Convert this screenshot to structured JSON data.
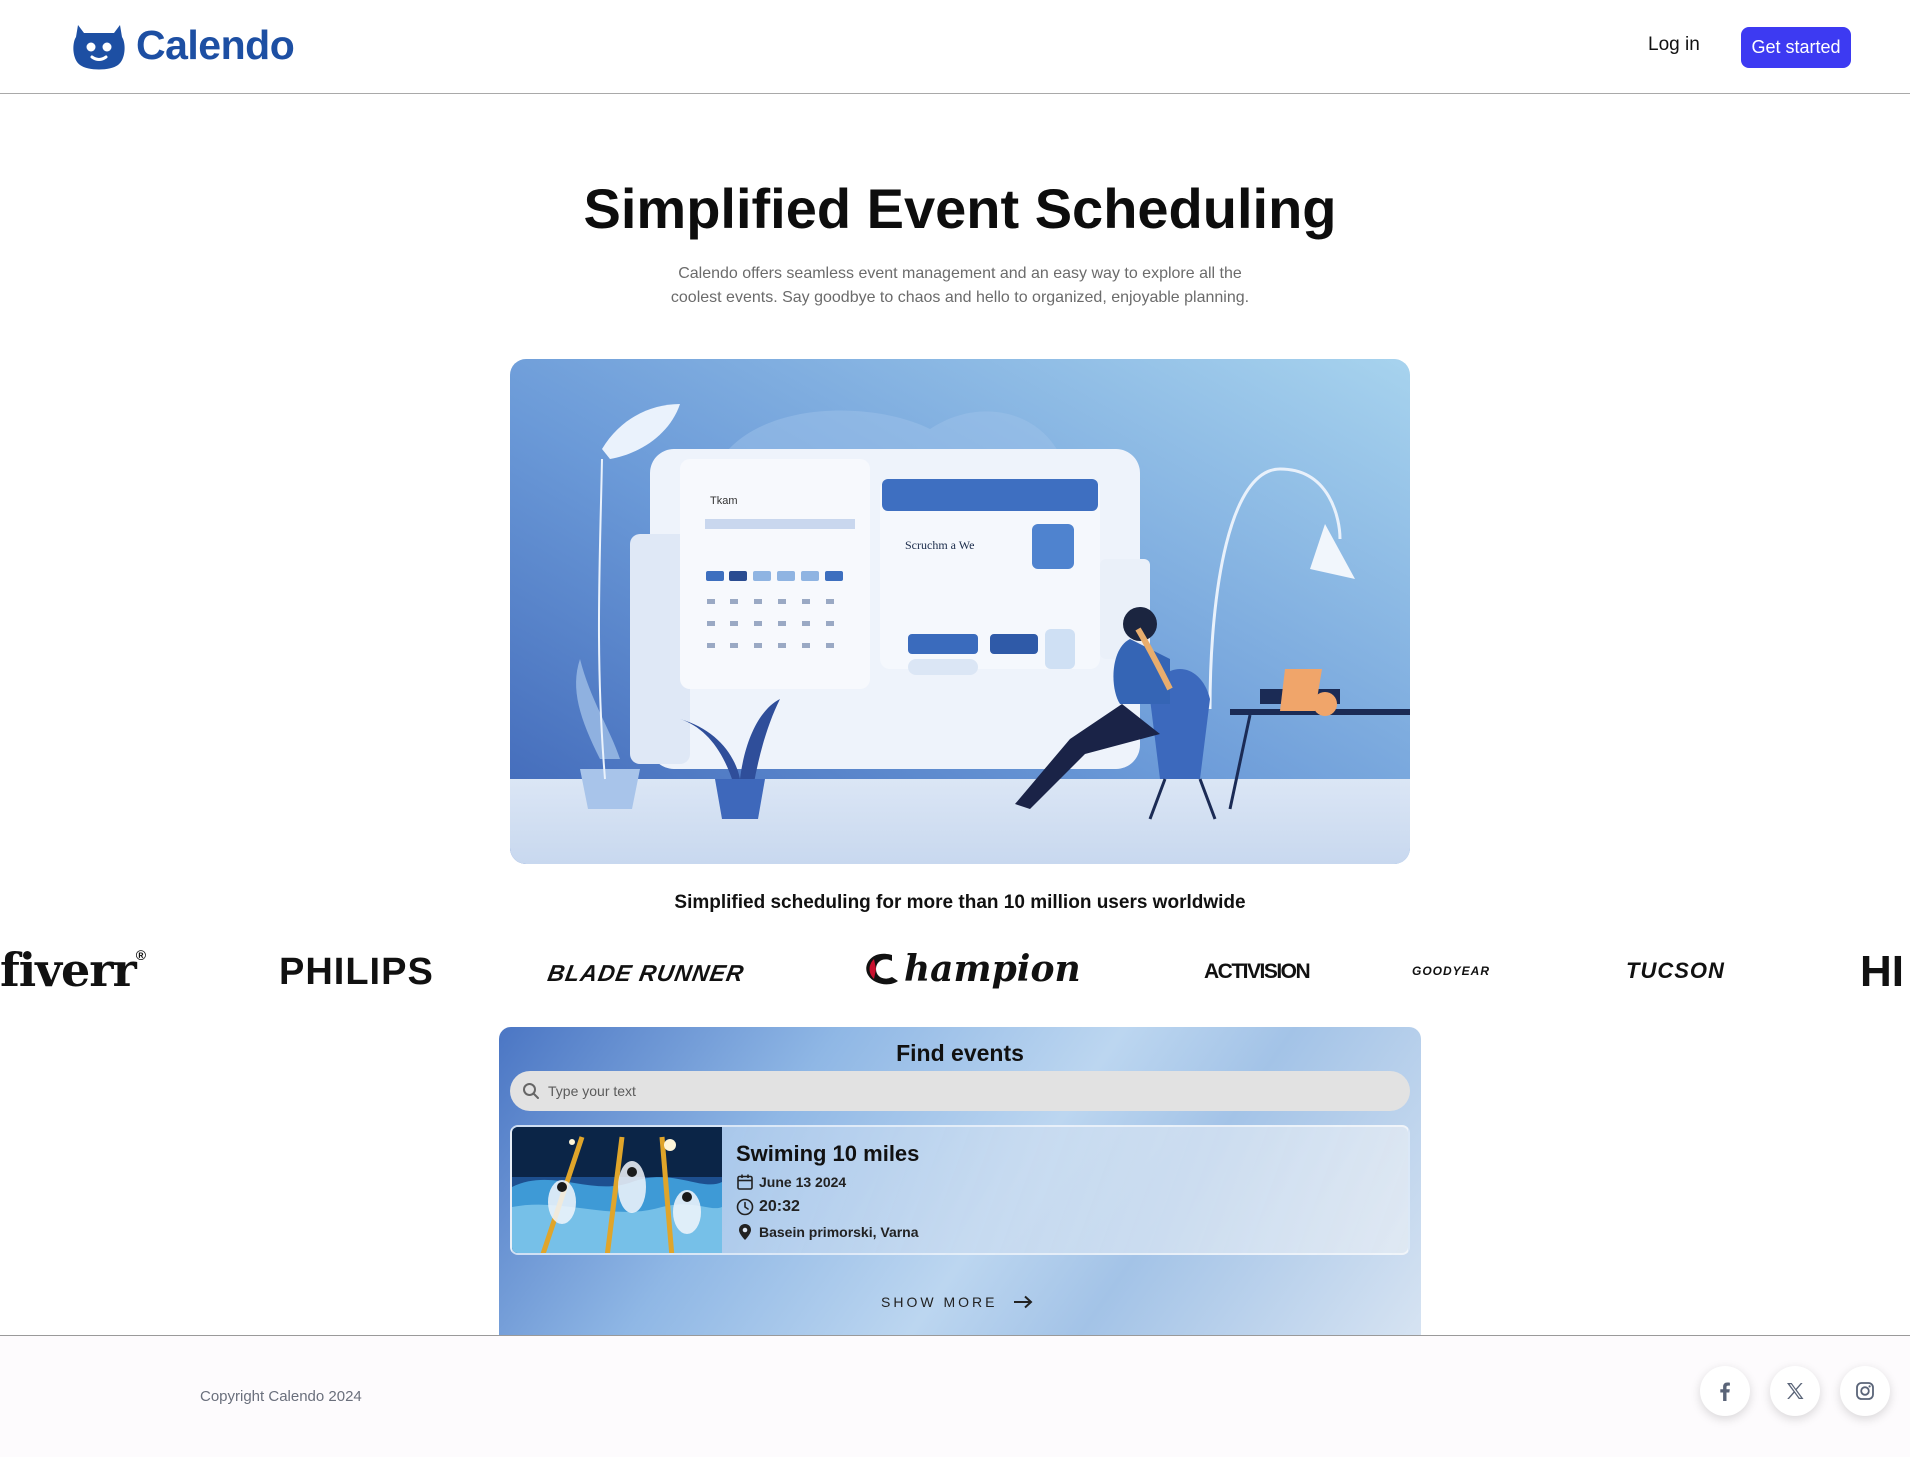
{
  "header": {
    "brand_name": "Calendo",
    "login_label": "Log in",
    "cta_label": "Get started",
    "brand_color": "#1d4fa3",
    "cta_color": "#3d3af2"
  },
  "hero": {
    "title": "Simplified Event Scheduling",
    "subtitle": "Calendo offers seamless event management and an easy way to explore all the coolest events. Say goodbye to chaos and hello to organized, enjoyable planning.",
    "illustration_labels": {
      "panel_left": "Tkam",
      "panel_right_title": "Scruchm a We"
    }
  },
  "users_line": "Simplified scheduling for more than 10 million users worldwide",
  "brands": [
    "fiverr",
    "PHILIPS",
    "BLADE RUNNER",
    "hampion",
    "ACTIVISION",
    "GOODYEAR",
    "TUCSON",
    "HI"
  ],
  "find_events": {
    "title": "Find events",
    "search_placeholder": "Type your text",
    "events": [
      {
        "title": "Swiming 10 miles",
        "date": "June 13 2024",
        "time": "20:32",
        "location": "Basein primorski, Varna"
      }
    ],
    "show_more_label": "SHOW MORE"
  },
  "footer": {
    "copyright": "Copyright Calendo 2024",
    "social_icons": [
      "facebook-icon",
      "x-icon",
      "instagram-icon"
    ]
  }
}
